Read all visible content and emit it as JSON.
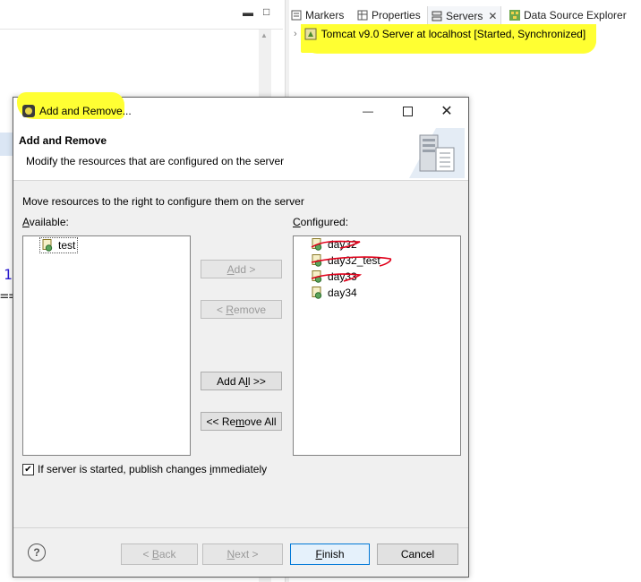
{
  "workbench": {
    "editor_line_number": "1",
    "editor_fragment": "==",
    "tabs": [
      {
        "label": "Markers",
        "icon": "markers-icon"
      },
      {
        "label": "Properties",
        "icon": "properties-icon"
      },
      {
        "label": "Servers",
        "icon": "servers-icon",
        "active": true,
        "close": "✕"
      },
      {
        "label": "Data Source Explorer",
        "icon": "data-source-explorer-icon"
      }
    ],
    "server_entry": "Tomcat v9.0 Server at localhost  [Started, Synchronized]",
    "left_controls": {
      "minimize": "▬",
      "maximize": "□"
    }
  },
  "dialog": {
    "title": "Add and Remove...",
    "window_controls": {
      "minimize": "—",
      "close": "✕"
    },
    "banner_title": "Add and Remove",
    "banner_description": "Modify the resources that are configured on the server",
    "instructions": "Move resources to the right to configure them on the server",
    "available_label": {
      "mnemonic": "A",
      "rest": "vailable:"
    },
    "configured_label": {
      "mnemonic": "C",
      "rest": "onfigured:"
    },
    "available_items": [
      "test"
    ],
    "configured_items": [
      "day32",
      "day32_test",
      "day33",
      "day34"
    ],
    "buttons": {
      "add": {
        "pre": "",
        "mn": "A",
        "post": "dd >"
      },
      "remove": {
        "pre": "< ",
        "mn": "R",
        "post": "emove"
      },
      "add_all": {
        "pre": "Add A",
        "mn": "l",
        "post": "l >>"
      },
      "remove_all": {
        "pre": "<< Re",
        "mn": "m",
        "post": "ove All"
      }
    },
    "publish_checkbox": {
      "checked": true,
      "pre": "If server is started, publish changes ",
      "mn": "i",
      "post": "mmediately"
    },
    "footer": {
      "help": "?",
      "back": {
        "pre": "< ",
        "mn": "B",
        "post": "ack"
      },
      "next": {
        "pre": "",
        "mn": "N",
        "post": "ext >"
      },
      "finish": {
        "pre": "",
        "mn": "F",
        "post": "inish"
      },
      "cancel": "Cancel"
    }
  },
  "colors": {
    "highlight": "#ffff33",
    "strike_red": "#e0001a",
    "dialog_bg": "#f0f0f0",
    "focus_blue": "#0078d7"
  }
}
